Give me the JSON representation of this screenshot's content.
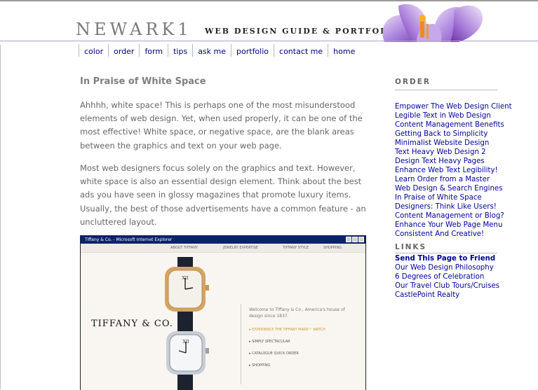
{
  "header": {
    "logo": "NEWARK1",
    "tagline": "WEB DESIGN GUIDE & PORTFOLIO"
  },
  "nav": [
    "color",
    "order",
    "form",
    "tips",
    "ask me",
    "portfolio",
    "contact me",
    "home"
  ],
  "article": {
    "title": "In Praise of White Space",
    "paragraphs": [
      "Ahhhh, white space! This is perhaps one of the most misunderstood elements of web design. Yet, when used properly, it can be one of the most effective! White space, or negative space, are the blank areas between the graphics and text on your web page.",
      "Most web designers focus solely on the graphics and text. However, white space is also an essential design element. Think about the best ads you have seen in glossy magazines that promote luxury items. Usually, the best of those advertisements have a common feature - an uncluttered layout."
    ]
  },
  "screenshot": {
    "window_title": "Tiffany & Co. - Microsoft Internet Explorer",
    "menu": [
      "ABOUT TIFFANY",
      "JEWELRY EXPERTISE",
      "TIFFANY STYLE",
      "SHOPPING"
    ],
    "logo": "TIFFANY & CO.",
    "welcome": "Welcome to Tiffany & Co., America's house of design since 1837.",
    "links": [
      "EXPERIENCE THE TIFFANY MARK™ WATCH",
      "SIMPLY SPECTACULAR",
      "CATALOGUE QUICK ORDER",
      "SHOPPING"
    ]
  },
  "sidebar": {
    "order_heading": "ORDER",
    "order_items": [
      "Empower The Web Design Client",
      "Legible Text in Web Design",
      "Content Management Benefits",
      "Getting Back to Simplicity",
      "Minimalist Website Design",
      "Text Heavy Web Design 2",
      "Design Text Heavy Pages",
      "Enhance Web Text Legibility!",
      "Learn Order from a Master",
      "Web Design & Search Engines",
      "In Praise of White Space",
      "Designers: Think Like Users!",
      "Content Management or Blog?",
      "Enhance Your Web Page Menu",
      "Consistent And Creative!"
    ],
    "links_heading": "LINKS",
    "link_items": [
      "Send This Page to Friend",
      "Our Web Design Philosophy",
      "6 Degrees of Celebration",
      "Our Travel Club Tours/Cruises",
      "CastlePoint Realty"
    ]
  },
  "colors": {
    "link": "#00009a",
    "nav_link": "#00007a",
    "heading_gray": "#7f7f7f",
    "body_text": "#666666",
    "flower_purple": "#9b6fd0",
    "titlebar_blue": "#0a246a"
  }
}
